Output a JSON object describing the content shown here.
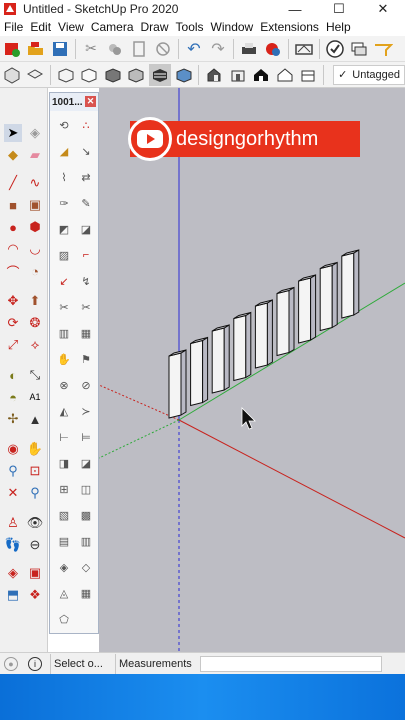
{
  "window": {
    "title": "Untitled - SketchUp Pro 2020",
    "minimize": "—",
    "maximize": "☐",
    "close": "✕"
  },
  "menu": [
    "File",
    "Edit",
    "View",
    "Camera",
    "Draw",
    "Tools",
    "Window",
    "Extensions",
    "Help"
  ],
  "toolbar": {
    "tag_value": "Untagged",
    "tag_check": "✓"
  },
  "tray": {
    "title": "1001...",
    "close": "✕"
  },
  "overlay": {
    "channel": "designgorhythm"
  },
  "status": {
    "select_hint": "Select o...",
    "measurements_label": "Measurements",
    "measurements_value": ""
  },
  "colors": {
    "accent": "#e8321c",
    "viewport_bg": "#bdbdc4",
    "axis_blue": "#2b2bd6",
    "axis_red": "#c8231e",
    "axis_green": "#2eaa3a"
  },
  "scene": {
    "object_count": 9
  }
}
